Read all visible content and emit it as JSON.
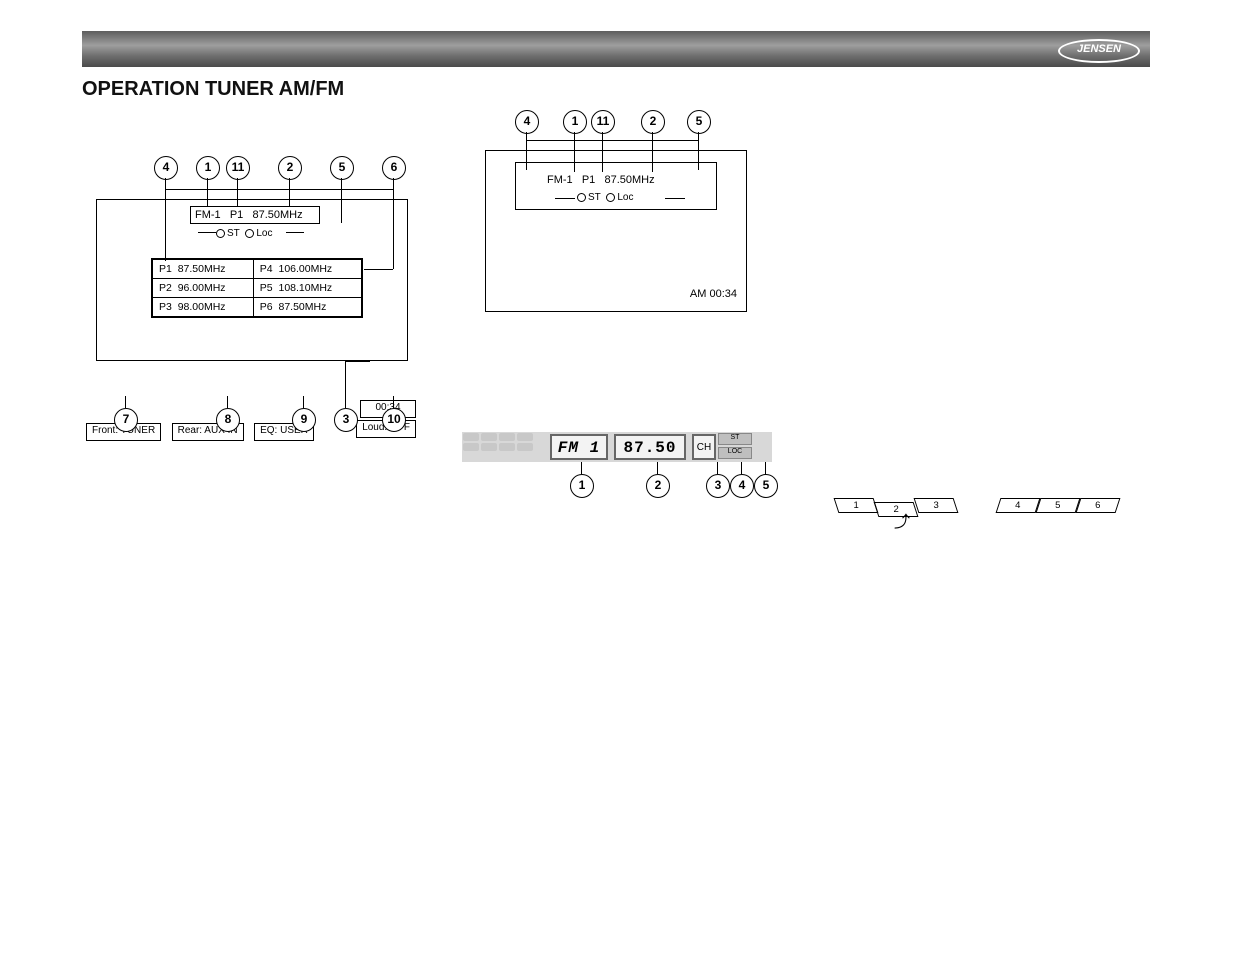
{
  "brand": "JENSEN",
  "title": "OPERATION TUNER AM/FM",
  "figA": {
    "callouts_top": [
      "4",
      "1",
      "11",
      "2",
      "5",
      "6"
    ],
    "callouts_bottom": [
      "7",
      "8",
      "9",
      "3",
      "10"
    ],
    "band": "FM-1",
    "preset_sel": "P1",
    "freq_sel": "87.50MHz",
    "st_label": "ST",
    "loc_label": "Loc",
    "presets": [
      {
        "p": "P1",
        "f": "87.50MHz"
      },
      {
        "p": "P2",
        "f": "96.00MHz"
      },
      {
        "p": "P3",
        "f": "98.00MHz"
      },
      {
        "p": "P4",
        "f": "106.00MHz"
      },
      {
        "p": "P5",
        "f": "108.10MHz"
      },
      {
        "p": "P6",
        "f": "87.50MHz"
      }
    ],
    "clock": "00:34",
    "status": {
      "front": "Front: TUNER",
      "rear": "Rear: AUX IN",
      "eq": "EQ: USER",
      "loud": "Loud: OFF"
    }
  },
  "figB": {
    "callouts_top": [
      "4",
      "1",
      "11",
      "2",
      "5"
    ],
    "band": "FM-1",
    "preset_sel": "P1",
    "freq_sel": "87.50MHz",
    "st_label": "ST",
    "loc_label": "Loc",
    "clock": "AM 00:34"
  },
  "figC": {
    "callouts": [
      "1",
      "2",
      "3",
      "4",
      "5"
    ],
    "band": "FM 1",
    "freq": "87.50",
    "ch_label": "CH",
    "tag1": "ST",
    "tag2": "LOC"
  },
  "keysLeft": [
    "1",
    "2",
    "3"
  ],
  "keysRight": [
    "4",
    "5",
    "6"
  ],
  "pressed_key_index": 1
}
